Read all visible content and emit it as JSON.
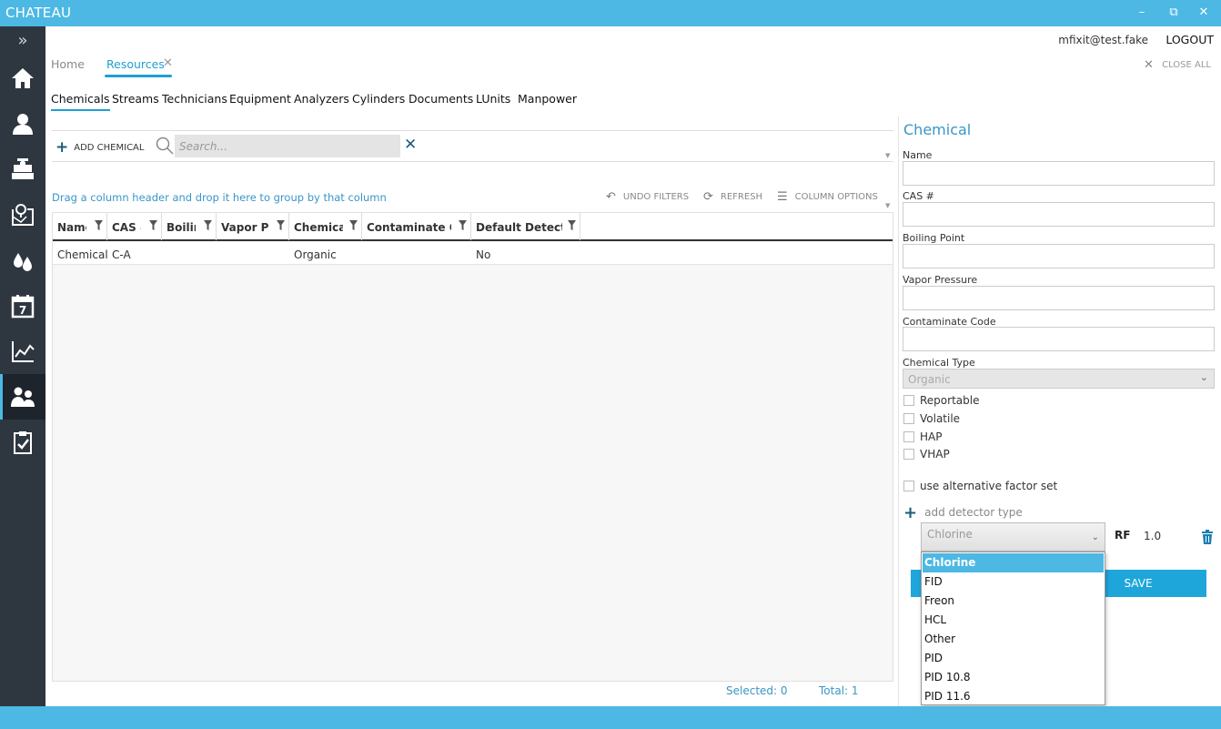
{
  "window": {
    "title": "CHATEAU",
    "minimize_glyph": "–",
    "restore_glyph": "⧉",
    "close_glyph": "✕"
  },
  "sidebar": {
    "expand_glyph": "»",
    "items": [
      {
        "icon": "home-icon"
      },
      {
        "icon": "user-icon"
      },
      {
        "icon": "pipe-valve-icon"
      },
      {
        "icon": "map-icon"
      },
      {
        "icon": "drops-icon"
      },
      {
        "icon": "calendar-icon",
        "text": "7"
      },
      {
        "icon": "chart-icon"
      },
      {
        "icon": "people-icon",
        "active": true
      },
      {
        "icon": "clipboard-check-icon"
      }
    ]
  },
  "user": {
    "email": "mfixit@test.fake",
    "logout_label": "LOGOUT"
  },
  "doc_tabs": {
    "home": "Home",
    "resources": "Resources",
    "close_glyph": "✕",
    "close_all_label": "CLOSE ALL"
  },
  "resource_tabs": [
    "Chemicals",
    "Streams",
    "Technicians",
    "Equipment",
    "Analyzers",
    "Cylinders",
    "Documents",
    "LUnits",
    "Manpower"
  ],
  "toolbar": {
    "add_label": "ADD CHEMICAL",
    "search_placeholder": "Search...",
    "clear_glyph": "✕"
  },
  "grid": {
    "group_hint": "Drag a column header and drop it here to group by that column",
    "undo_filters_label": "UNDO FILTERS",
    "refresh_label": "REFRESH",
    "column_options_label": "COLUMN OPTIONS",
    "columns": [
      "Name",
      "CAS #",
      "Boiling Point",
      "Vapor Pressure",
      "Chemical Type",
      "Contaminate Code",
      "Default Detector"
    ],
    "rows": [
      [
        "Chemical",
        "C-A",
        "",
        "",
        "Organic",
        "",
        "No"
      ]
    ],
    "selected_label": "Selected: 0",
    "total_label": "Total: 1"
  },
  "detail": {
    "title": "Chemical",
    "labels": {
      "name": "Name",
      "cas": "CAS #",
      "boiling_point": "Boiling Point",
      "vapor_pressure": "Vapor Pressure",
      "contaminate_code": "Contaminate Code",
      "chemical_type": "Chemical Type"
    },
    "chemical_type_value": "Organic",
    "checkboxes": {
      "reportable": "Reportable",
      "volatile": "Volatile",
      "hap": "HAP",
      "vhap": "VHAP",
      "alt_factor": "use alternative factor set"
    },
    "add_detector_label": "add detector type",
    "detector_value": "Chlorine",
    "rf_label": "RF",
    "rf_value": "1.0",
    "save_label": "SAVE",
    "detector_options": [
      "Chlorine",
      "FID",
      "Freon",
      "HCL",
      "Other",
      "PID",
      "PID 10.8",
      "PID 11.6"
    ]
  },
  "colors": {
    "accent": "#4cb8e3",
    "sidebar": "#2e3640",
    "link": "#3a96c6",
    "save": "#1ea6db"
  }
}
